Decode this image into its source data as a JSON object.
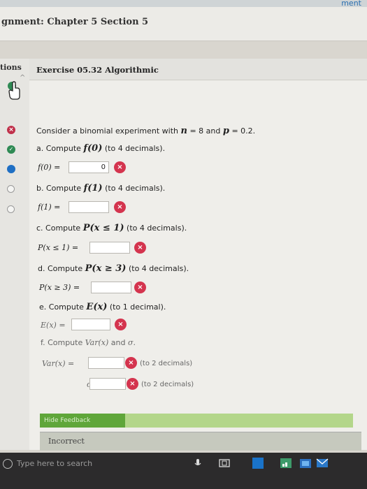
{
  "header": {
    "title": "gnment: Chapter 5 Section 5",
    "brand_fragment": "ment"
  },
  "sidebar": {
    "tab_label": "tions",
    "questions": [
      {
        "status": "incorrect"
      },
      {
        "status": "correct"
      },
      {
        "status": "current"
      },
      {
        "status": "unanswered"
      },
      {
        "status": "unanswered"
      }
    ]
  },
  "exercise": {
    "title": "Exercise 05.32 Algorithmic",
    "intro_prefix": "Consider a binomial experiment with",
    "n_symbol": "n",
    "n_value": "= 8",
    "and": "and",
    "p_symbol": "p",
    "p_value": "= 0.2.",
    "parts": [
      {
        "label": "a. Compute",
        "func": "f(0)",
        "note": "(to 4 decimals).",
        "answer_label": "f(0) =",
        "value": "0"
      },
      {
        "label": "b. Compute",
        "func": "f(1)",
        "note": "(to 4 decimals).",
        "answer_label": "f(1) =",
        "value": ""
      },
      {
        "label": "c. Compute",
        "func": "P(x ≤ 1)",
        "note": "(to 4 decimals).",
        "answer_label": "P(x ≤ 1) =",
        "value": ""
      },
      {
        "label": "d. Compute",
        "func": "P(x ≥ 3)",
        "note": "(to 4 decimals).",
        "answer_label": "P(x ≥ 3) =",
        "value": ""
      },
      {
        "label": "e. Compute",
        "func": "E(x)",
        "note": "(to 1 decimal).",
        "answer_label": "E(x) =",
        "value": ""
      }
    ],
    "part_f": {
      "label": "f. Compute",
      "func": "Var(x)",
      "and": "and",
      "sigma": "σ.",
      "var_label": "Var(x) =",
      "var_note": "(to 2 decimals)",
      "sigma_label": "σ =",
      "sigma_note": "(to 2 decimals)"
    },
    "feedback_button": "Hide Feedback",
    "result": "Incorrect"
  },
  "taskbar": {
    "search_placeholder": "Type here to search"
  },
  "colors": {
    "incorrect": "#d4344e",
    "correct": "#2f8a54",
    "current": "#1f6fc4",
    "feedback_green": "#5fa63a"
  }
}
